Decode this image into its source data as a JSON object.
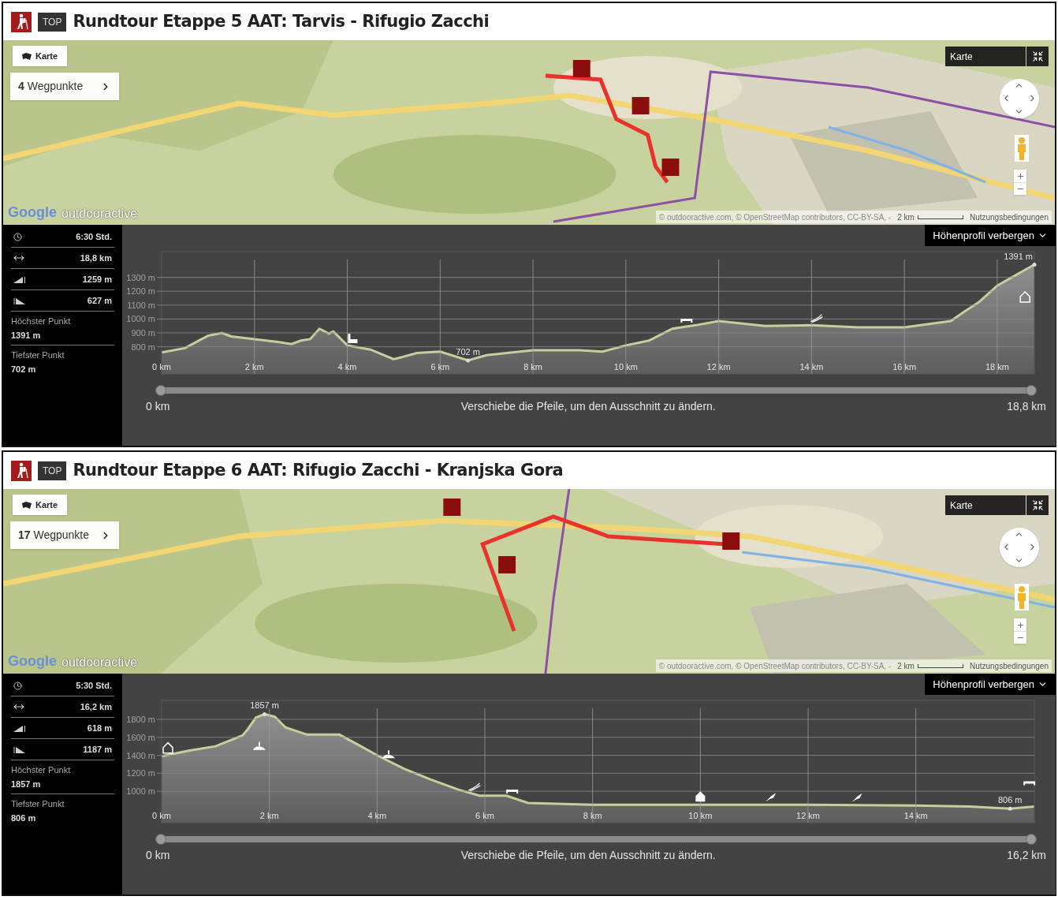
{
  "tours": [
    {
      "badge": "TOP",
      "title": "Rundtour Etappe 5 AAT: Tarvis - Rifugio Zacchi",
      "map": {
        "kind": "picture",
        "layer_button": "Karte",
        "waypoints": "**4** Wegpunkte",
        "layer_select": "Karte",
        "logos": [
          "Google",
          "outdooractive"
        ],
        "attribution": "© outdooractive.com, © OpenStreetMap contributors, CC-BY-SA, -",
        "scale": "2 km",
        "terms": "Nutzungsbedingungen"
      },
      "stats": [
        {
          "kind": "duration",
          "value": "6:30 Std."
        },
        {
          "kind": "distance",
          "value": "18,8 km"
        },
        {
          "kind": "ascent",
          "value": "1259 m"
        },
        {
          "kind": "descent",
          "value": "627 m"
        }
      ],
      "extremes": [
        {
          "label": "Höchster Punkt",
          "value": "1391 m"
        },
        {
          "label": "Tiefster Punkt",
          "value": "702 m"
        }
      ],
      "profile": {
        "toggle": "Höhenprofil verbergen",
        "chart_data": {
          "type": "area",
          "grid": true,
          "x": [
            0,
            0.5,
            1,
            1.3,
            1.5,
            2,
            2.5,
            2.8,
            3,
            3.2,
            3.4,
            3.6,
            3.7,
            4,
            4.5,
            5,
            5.5,
            6,
            6.6,
            7,
            8,
            9,
            9.5,
            10,
            10.5,
            11,
            11.5,
            12,
            13,
            14,
            15,
            16,
            17,
            17.3,
            17.6,
            18,
            18.8
          ],
          "values": [
            760,
            790,
            880,
            900,
            875,
            855,
            835,
            820,
            845,
            855,
            930,
            895,
            910,
            810,
            780,
            710,
            755,
            765,
            702,
            740,
            775,
            775,
            765,
            810,
            845,
            930,
            955,
            985,
            950,
            955,
            940,
            940,
            985,
            1055,
            1120,
            1240,
            1391
          ],
          "xlim": [
            0,
            18.8
          ],
          "ylim": [
            605,
            1485
          ],
          "xticks": [
            {
              "value": 0,
              "label": "0 km"
            },
            {
              "value": 2,
              "label": "2 km"
            },
            {
              "value": 4,
              "label": "4 km"
            },
            {
              "value": 6,
              "label": "6 km"
            },
            {
              "value": 8,
              "label": "8 km"
            },
            {
              "value": 10,
              "label": "10 km"
            },
            {
              "value": 12,
              "label": "12 km"
            },
            {
              "value": 14,
              "label": "14 km"
            },
            {
              "value": 16,
              "label": "16 km"
            },
            {
              "value": 18,
              "label": "18 km"
            }
          ],
          "yticks": [
            {
              "value": 800,
              "label": "800 m"
            },
            {
              "value": 900,
              "label": "900 m"
            },
            {
              "value": 1000,
              "label": "1000 m"
            },
            {
              "value": 1100,
              "label": "1100 m"
            },
            {
              "value": 1200,
              "label": "1200 m"
            },
            {
              "value": 1300,
              "label": "1300 m"
            }
          ],
          "annotations": [
            {
              "x": 18.8,
              "y": 1391,
              "text": "1391 m"
            },
            {
              "x": 6.6,
              "y": 702,
              "text": "702 m"
            }
          ]
        },
        "slider": {
          "start": "0 km",
          "hint": "Verschiebe die Pfeile, um den Ausschnitt zu ändern.",
          "end": "18,8 km",
          "level": 1
        }
      }
    },
    {
      "badge": "TOP",
      "title": "Rundtour Etappe 6 AAT: Rifugio Zacchi - Kranjska Gora",
      "map": {
        "kind": "picture",
        "layer_button": "Karte",
        "waypoints": "**17** Wegpunkte",
        "layer_select": "Karte",
        "logos": [
          "Google",
          "outdooractive"
        ],
        "attribution": "© outdooractive.com, © OpenStreetMap contributors, CC-BY-SA, -",
        "scale": "2 km",
        "terms": "Nutzungsbedingungen"
      },
      "stats": [
        {
          "kind": "duration",
          "value": "5:30 Std."
        },
        {
          "kind": "distance",
          "value": "16,2 km"
        },
        {
          "kind": "ascent",
          "value": "618 m"
        },
        {
          "kind": "descent",
          "value": "1187 m"
        }
      ],
      "extremes": [
        {
          "label": "Höchster Punkt",
          "value": "1857 m"
        },
        {
          "label": "Tiefster Punkt",
          "value": "806 m"
        }
      ],
      "profile": {
        "toggle": "Höhenprofil verbergen",
        "chart_data": {
          "type": "area",
          "grid": true,
          "x": [
            0,
            0.5,
            1,
            1.5,
            1.6,
            1.75,
            1.91,
            2.1,
            2.3,
            2.7,
            3.3,
            3.7,
            4,
            4.5,
            5,
            5.5,
            5.9,
            6.4,
            6.8,
            8,
            10,
            12,
            14,
            15,
            15.75,
            16.2
          ],
          "values": [
            1390,
            1450,
            1500,
            1620,
            1690,
            1820,
            1857,
            1830,
            1710,
            1630,
            1630,
            1500,
            1400,
            1250,
            1130,
            1020,
            950,
            950,
            870,
            850,
            850,
            850,
            840,
            830,
            806,
            830
          ],
          "xlim": [
            0,
            16.2
          ],
          "ylim": [
            650,
            2010
          ],
          "xticks": [
            {
              "value": 0,
              "label": "0 km"
            },
            {
              "value": 2,
              "label": "2 km"
            },
            {
              "value": 4,
              "label": "4 km"
            },
            {
              "value": 6,
              "label": "6 km"
            },
            {
              "value": 8,
              "label": "8 km"
            },
            {
              "value": 10,
              "label": "10 km"
            },
            {
              "value": 12,
              "label": "12 km"
            },
            {
              "value": 14,
              "label": "14 km"
            }
          ],
          "yticks": [
            {
              "value": 1000,
              "label": "1000 m"
            },
            {
              "value": 1200,
              "label": "1200 m"
            },
            {
              "value": 1400,
              "label": "1400 m"
            },
            {
              "value": 1600,
              "label": "1600 m"
            },
            {
              "value": 1800,
              "label": "1800 m"
            }
          ],
          "annotations": [
            {
              "x": 1.91,
              "y": 1857,
              "text": "1857 m"
            },
            {
              "x": 15.75,
              "y": 806,
              "text": "806 m"
            }
          ]
        },
        "slider": {
          "start": "0 km",
          "hint": "Verschiebe die Pfeile, um den Ausschnitt zu ändern.",
          "end": "16,2 km",
          "level": 1
        }
      }
    }
  ]
}
